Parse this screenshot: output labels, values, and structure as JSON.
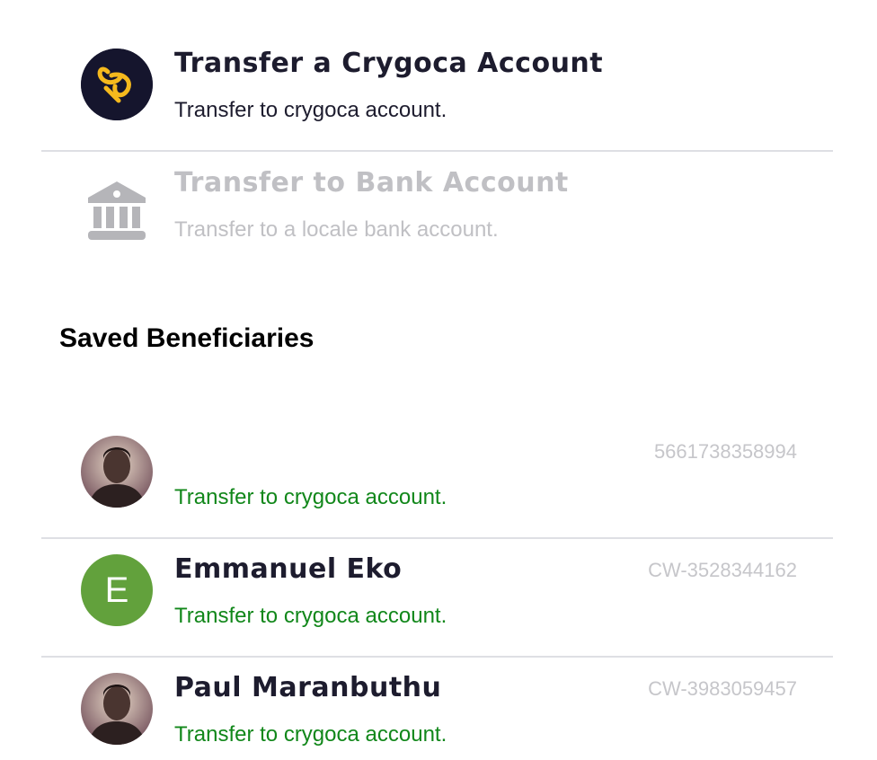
{
  "transfer_options": [
    {
      "title": "Transfer a Crygoca Account",
      "subtitle": "Transfer to crygoca account.",
      "icon": "crygoca-logo-icon",
      "enabled": true
    },
    {
      "title": "Transfer to Bank Account",
      "subtitle": "Transfer to a locale bank account.",
      "icon": "bank-icon",
      "enabled": false
    }
  ],
  "beneficiaries_heading": "Saved Beneficiaries",
  "beneficiaries": [
    {
      "name": "",
      "account": "5661738358994",
      "subtitle": "Transfer to crygoca account.",
      "avatar": "photo"
    },
    {
      "name": "Emmanuel Eko",
      "account": "CW-3528344162",
      "subtitle": "Transfer to crygoca account.",
      "avatar": "E",
      "avatar_color": "#62a13c"
    },
    {
      "name": "Paul Maranbuthu",
      "account": "CW-3983059457",
      "subtitle": "Transfer to crygoca account.",
      "avatar": "photo"
    }
  ],
  "colors": {
    "title": "#1d1c2e",
    "disabled": "#c0c0c4",
    "success_green": "#11871a",
    "divider": "#dedfe4",
    "logo_bg": "#15152d",
    "logo_accent": "#f5b91d"
  }
}
